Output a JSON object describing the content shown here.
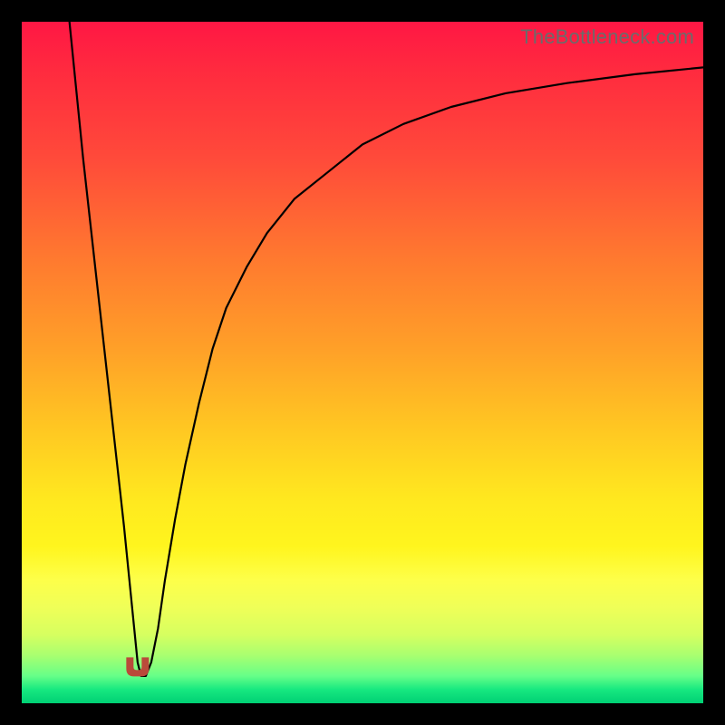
{
  "watermark": "TheBottleneck.com",
  "colors": {
    "page_bg": "#000000",
    "gradient_top": "#ff1744",
    "gradient_mid": "#ffe81f",
    "gradient_bottom": "#00d074",
    "curve": "#000000",
    "valley_marker": "#ba4a3a"
  },
  "chart_data": {
    "type": "line",
    "title": "",
    "xlabel": "",
    "ylabel": "",
    "xlim": [
      0,
      100
    ],
    "ylim": [
      0,
      100
    ],
    "grid": false,
    "legend": false,
    "note": "Axes carry no printed tick labels in the source image; values below are read proportionally from the plot area (0–100 on each axis). The curve is a V-shaped bottleneck profile with a sharp near-linear descent on the left, a minimum around x≈17, and a concave-down recovery toward the right.",
    "series": [
      {
        "name": "bottleneck-curve",
        "color": "#000000",
        "x": [
          7,
          8,
          9,
          10,
          11,
          12,
          13,
          14,
          15,
          15.8,
          16.5,
          17,
          17.5,
          18.2,
          19,
          20,
          21,
          22.5,
          24,
          26,
          28,
          30,
          33,
          36,
          40,
          45,
          50,
          56,
          63,
          71,
          80,
          90,
          100
        ],
        "y": [
          100,
          90,
          80,
          71,
          62,
          53,
          44,
          35,
          26,
          18,
          11,
          6,
          4,
          4,
          6,
          11,
          18,
          27,
          35,
          44,
          52,
          58,
          64,
          69,
          74,
          78,
          82,
          85,
          87.5,
          89.5,
          91,
          92.3,
          93.3
        ]
      }
    ],
    "annotations": [
      {
        "name": "valley-marker",
        "x": 17,
        "y": 4,
        "shape": "small-u",
        "color": "#ba4a3a"
      }
    ]
  }
}
